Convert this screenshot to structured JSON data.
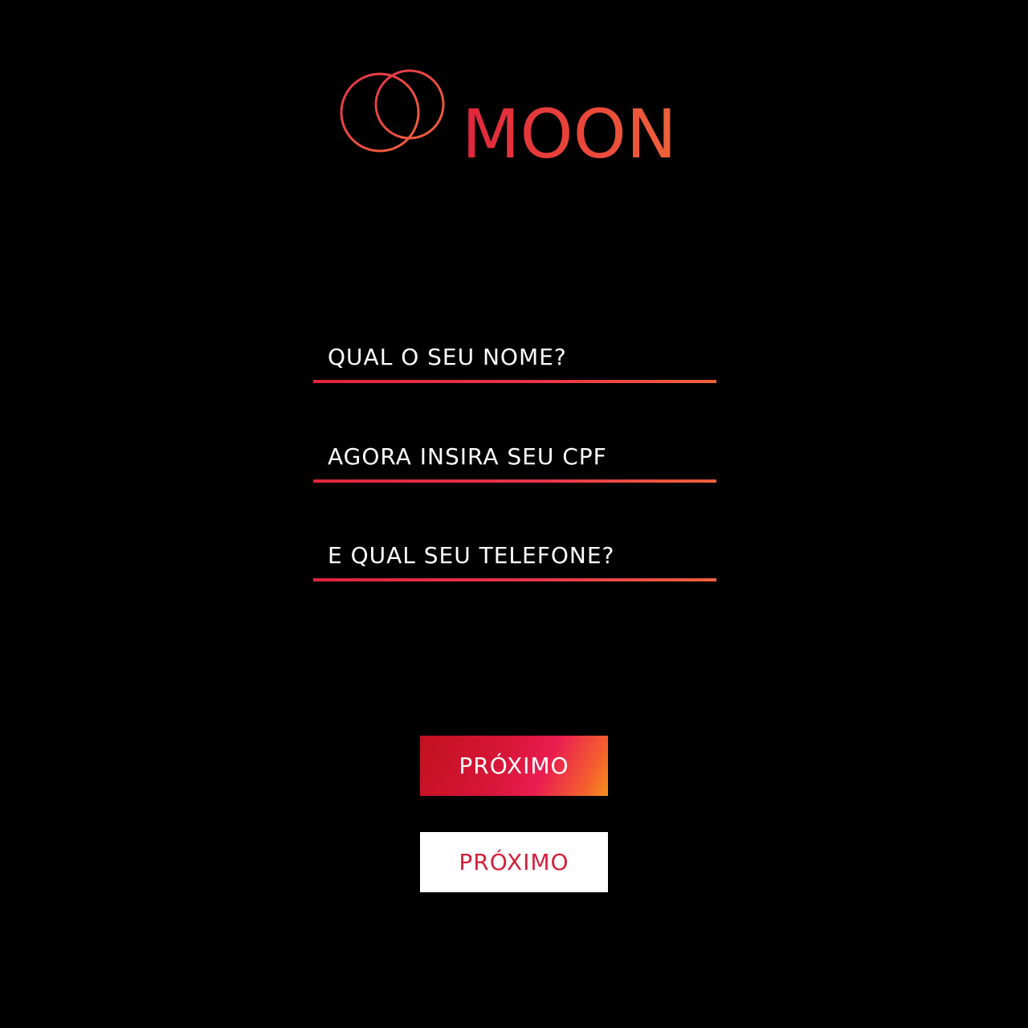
{
  "brand": {
    "name": "MOON",
    "accent_red": "#e0253b",
    "accent_orange": "#f0623a"
  },
  "form": {
    "fields": [
      {
        "placeholder": "QUAL O SEU NOME?",
        "value": ""
      },
      {
        "placeholder": "AGORA INSIRA SEU CPF",
        "value": ""
      },
      {
        "placeholder": "E QUAL SEU TELEFONE?",
        "value": ""
      }
    ]
  },
  "buttons": {
    "primary_label": "PRÓXIMO",
    "secondary_label": "PRÓXIMO"
  }
}
